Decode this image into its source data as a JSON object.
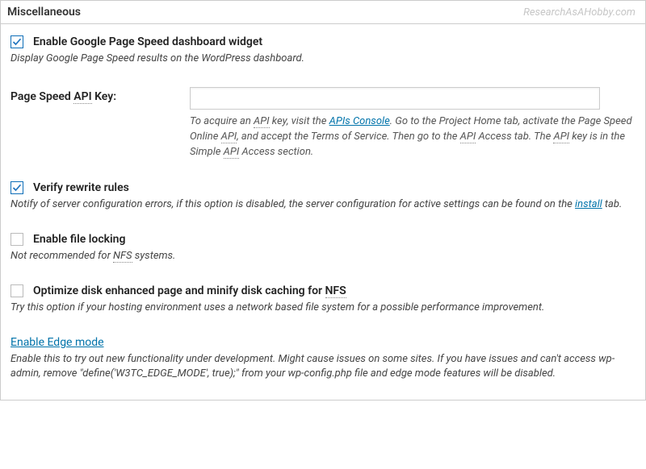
{
  "header": {
    "title": "Miscellaneous",
    "watermark": "ResearchAsAHobby.com"
  },
  "opt1": {
    "label": "Enable Google Page Speed dashboard widget",
    "desc": "Display Google Page Speed results on the WordPress dashboard."
  },
  "apiKey": {
    "label_prefix": "Page Speed ",
    "label_api": "API",
    "label_suffix": " Key:",
    "help_1": "To acquire an ",
    "help_api1": "API",
    "help_2": " key, visit the ",
    "help_link": "APIs Console",
    "help_3": ". Go to the Project Home tab, activate the Page Speed Online ",
    "help_api2": "API",
    "help_4": ", and accept the Terms of Service. Then go to the ",
    "help_api3": "API",
    "help_5": " Access tab. The ",
    "help_api4": "API",
    "help_6": " key is in the Simple ",
    "help_api5": "API",
    "help_7": " Access section."
  },
  "opt2": {
    "label": "Verify rewrite rules",
    "desc_1": "Notify of server configuration errors, if this option is disabled, the server configuration for active settings can be found on the ",
    "desc_link": "install",
    "desc_2": " tab."
  },
  "opt3": {
    "label": "Enable file locking",
    "desc_1": "Not recommended for ",
    "desc_nfs": "NFS",
    "desc_2": " systems."
  },
  "opt4": {
    "label_1": "Optimize disk enhanced page and minify disk caching for ",
    "label_nfs": "NFS",
    "desc": "Try this option if your hosting environment uses a network based file system for a possible performance improvement."
  },
  "opt5": {
    "label": "Enable Edge mode",
    "desc": "Enable this to try out new functionality under development. Might cause issues on some sites. If you have issues and can't access wp-admin, remove \"define('W3TC_EDGE_MODE', true);\" from your wp-config.php file and edge mode features will be disabled."
  }
}
